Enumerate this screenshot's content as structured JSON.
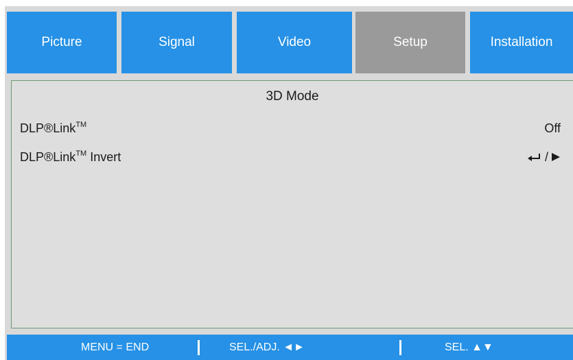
{
  "tabs": [
    {
      "label": "Picture",
      "active": false
    },
    {
      "label": "Signal",
      "active": false
    },
    {
      "label": "Video",
      "active": false
    },
    {
      "label": "Setup",
      "active": true
    },
    {
      "label": "Installation",
      "active": false
    }
  ],
  "panel": {
    "title": "3D Mode",
    "rows": [
      {
        "label": "DLP®Link",
        "superscript": "TM",
        "suffix": "",
        "value": "Off"
      },
      {
        "label": "DLP®Link",
        "superscript": "TM",
        "suffix": " Invert",
        "value_icons": [
          "enter-icon",
          "right-arrow-icon"
        ],
        "value_separator": "/"
      }
    ]
  },
  "footer": {
    "menu": "MENU = END",
    "sel_adj": "SEL./ADJ. ◄►",
    "sel": "SEL. ▲▼"
  },
  "colors": {
    "tab": "#2691e6",
    "tab_active": "#9a9a9a",
    "panel": "#dedede",
    "panel_border": "#6c9a72",
    "footer": "#2691e6"
  }
}
